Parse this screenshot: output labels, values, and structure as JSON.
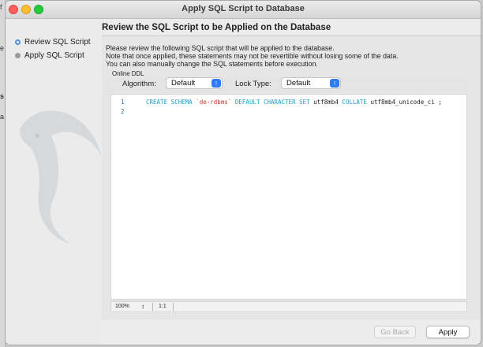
{
  "background_fragments": [
    "f",
    "e",
    "s",
    "a"
  ],
  "window": {
    "title": "Apply SQL Script to Database"
  },
  "sidebar": {
    "steps": [
      {
        "label": "Review SQL Script",
        "state": "active"
      },
      {
        "label": "Apply SQL Script",
        "state": "inactive"
      }
    ]
  },
  "header": {
    "title": "Review the SQL Script to be Applied on the Database"
  },
  "description": [
    "Please review the following SQL script that will be applied to the database.",
    "Note that once applied, these statements may not be revertible without losing some of the data.",
    "You can also manually change the SQL statements before execution."
  ],
  "online_ddl": {
    "label": "Online DDL",
    "algorithm_label": "Algorithm:",
    "algorithm_value": "Default",
    "lock_label": "Lock Type:",
    "lock_value": "Default"
  },
  "editor": {
    "lines": [
      {
        "number": "1",
        "tokens": [
          {
            "type": "kw",
            "text": "CREATE SCHEMA "
          },
          {
            "type": "str",
            "text": "`de-rdbms`"
          },
          {
            "type": "kw",
            "text": " DEFAULT CHARACTER SET "
          },
          {
            "type": "plain",
            "text": "utf8mb4 "
          },
          {
            "type": "kw",
            "text": "COLLATE "
          },
          {
            "type": "plain",
            "text": "utf8mb4_unicode_ci ;"
          }
        ]
      },
      {
        "number": "2",
        "tokens": []
      }
    ]
  },
  "statusbar": {
    "zoom": "100%",
    "position": "1:1"
  },
  "buttons": {
    "back": "Go Back",
    "apply": "Apply"
  },
  "colors": {
    "keyword": "#1e9cc8",
    "string": "#c0392b",
    "accent": "#2f7bf6",
    "close": "#ff5f57",
    "minimize": "#febc2e",
    "zoom": "#28c840"
  }
}
